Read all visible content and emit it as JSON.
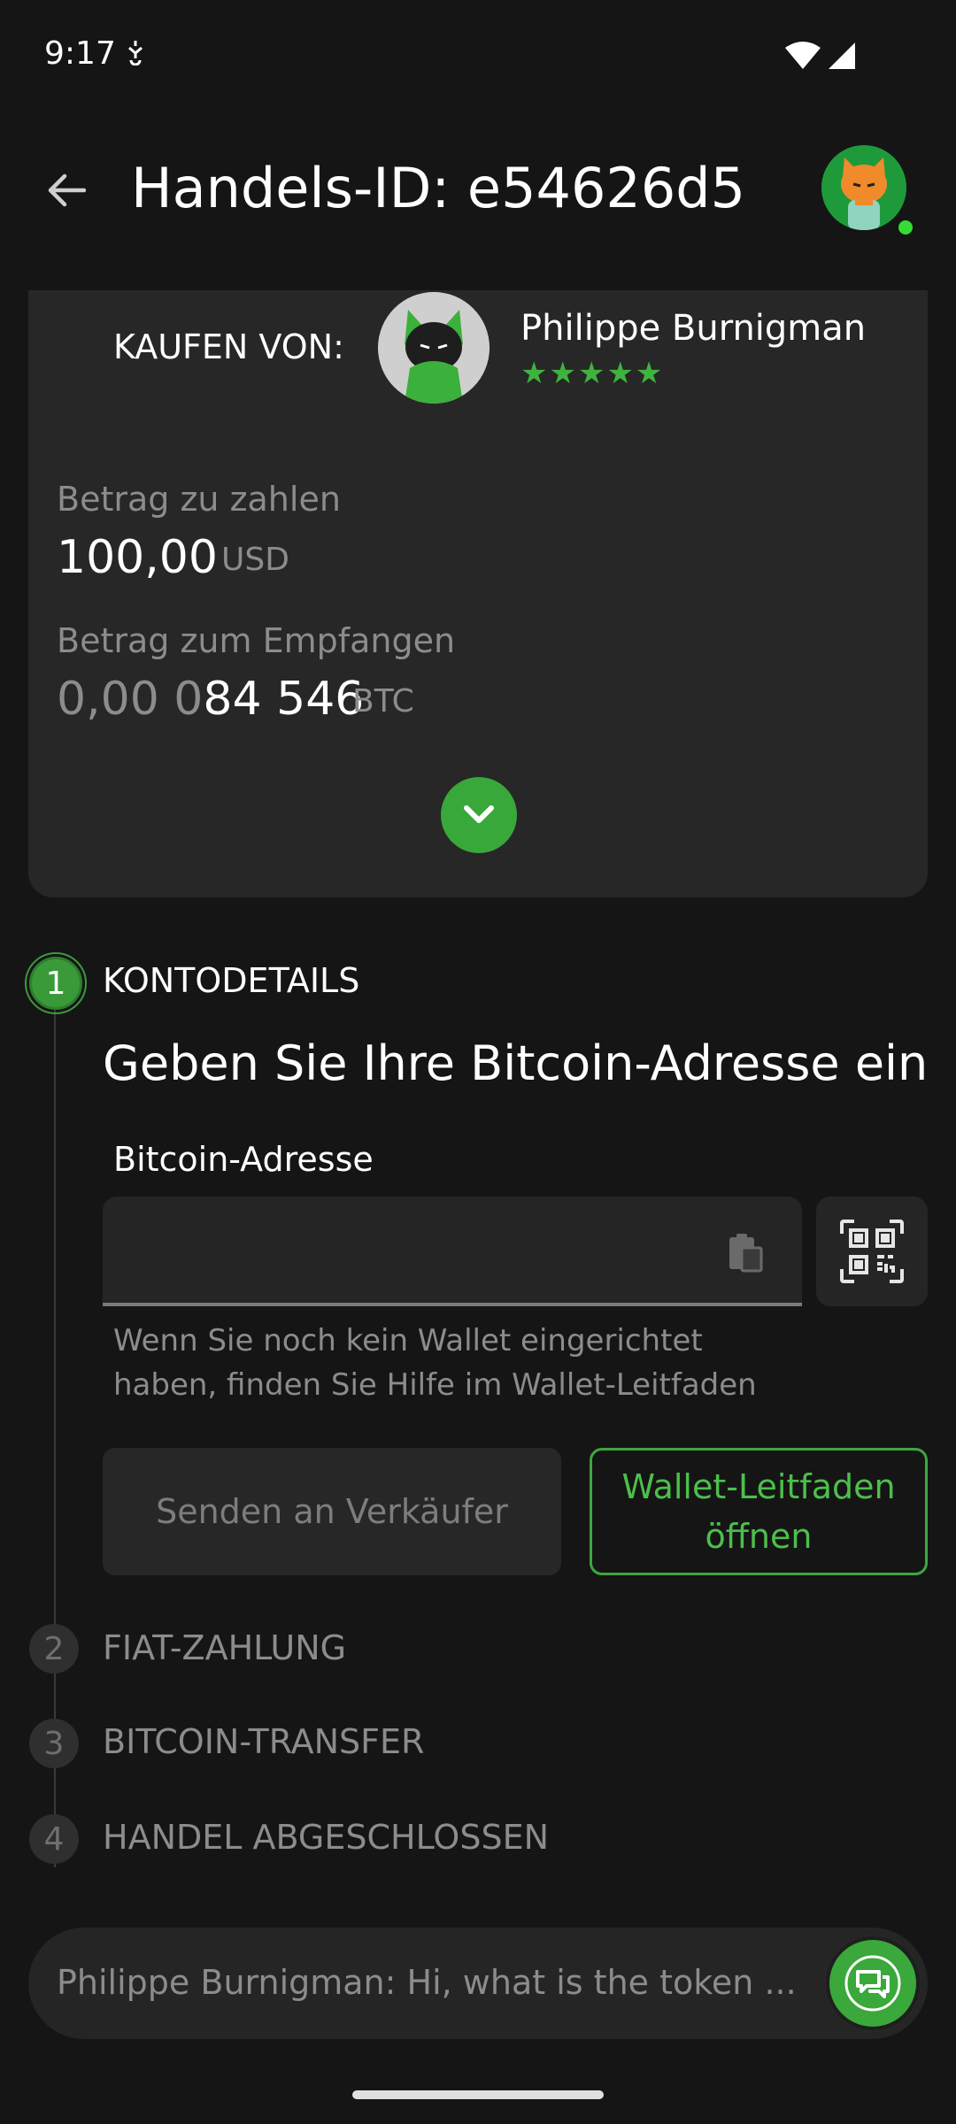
{
  "status_bar": {
    "time": "9:17",
    "extra_icon": "nfc-icon",
    "wifi": "wifi-icon",
    "signal": "signal-icon"
  },
  "header": {
    "title": "Handels-ID: e54626d5",
    "back_icon": "arrow-back-icon",
    "avatar_icon": "cat-avatar-icon",
    "online": true
  },
  "trade_card": {
    "buy_from_label": "KAUFEN VON:",
    "seller_name": "Philippe Burnigman",
    "seller_rating_stars": "★★★★★",
    "rating_value": 5,
    "amount_to_pay_label": "Betrag zu zahlen",
    "amount_to_pay": "100,00",
    "amount_to_pay_currency": "USD",
    "amount_to_receive_label": "Betrag zum Empfangen",
    "amount_to_receive_dim": "0,00 0",
    "amount_to_receive_bright": "84 546",
    "amount_to_receive_currency": "BTC",
    "expand_icon": "chevron-down-icon"
  },
  "steps": [
    {
      "number": "1",
      "title": "KONTODETAILS",
      "active": true
    },
    {
      "number": "2",
      "title": "FIAT-ZAHLUNG",
      "active": false
    },
    {
      "number": "3",
      "title": "BITCOIN-TRANSFER",
      "active": false
    },
    {
      "number": "4",
      "title": "HANDEL ABGESCHLOSSEN",
      "active": false
    }
  ],
  "account_details": {
    "headline": "Geben Sie Ihre Bitcoin-Adresse ein",
    "field_label": "Bitcoin-Adresse",
    "field_value": "",
    "field_placeholder": "",
    "paste_icon": "clipboard-icon",
    "qr_icon": "qr-scan-icon",
    "helper_text": "Wenn Sie noch kein Wallet eingerichtet haben, finden Sie Hilfe im Wallet-Leitfaden",
    "send_button": "Senden an Verkäufer",
    "guide_button": "Wallet-Leitfaden öffnen"
  },
  "chat": {
    "preview": "Philippe Burnigman: Hi, what is the token ...",
    "chat_icon": "chat-bubbles-icon"
  },
  "colors": {
    "accent": "#3aa83a",
    "background": "#151515",
    "card": "#272727"
  }
}
